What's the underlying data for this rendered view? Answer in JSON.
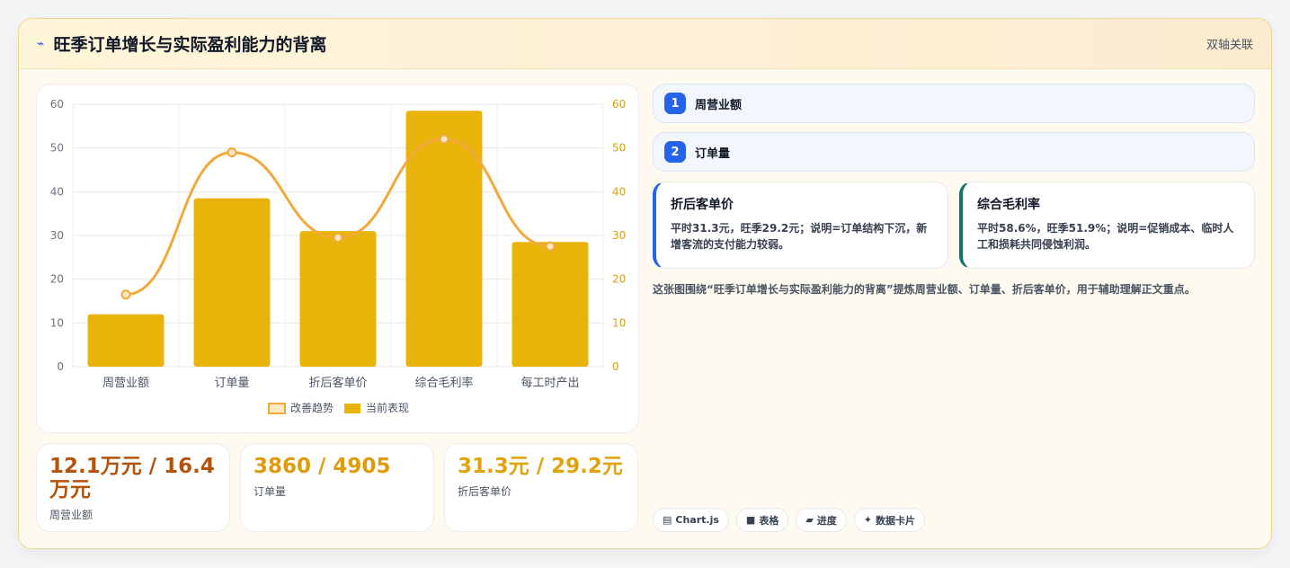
{
  "header": {
    "icon": "trend-icon",
    "title": "旺季订单增长与实际盈利能力的背离",
    "tag": "双轴关联"
  },
  "chart_data": {
    "type": "bar",
    "categories": [
      "周营业额",
      "订单量",
      "折后客单价",
      "综合毛利率",
      "每工时产出"
    ],
    "series": [
      {
        "name": "改善趋势",
        "type": "line",
        "values": [
          16.5,
          49,
          29.5,
          52,
          27.5
        ],
        "color": "#f2a93b"
      },
      {
        "name": "当前表现",
        "type": "bar",
        "values": [
          12,
          38.5,
          31,
          58.5,
          28.5
        ],
        "color": "#e8b40a"
      }
    ],
    "ylim": [
      0,
      60
    ],
    "yticks": [
      0,
      10,
      20,
      30,
      40,
      50,
      60
    ],
    "y2lim": [
      0,
      60
    ],
    "y2ticks": [
      0,
      10,
      20,
      30,
      40,
      50,
      60
    ],
    "grid": true,
    "legend": "bottom"
  },
  "stats": [
    {
      "value": "12.1万元 / 16.4万元",
      "label": "周营业额",
      "color": "#b45309"
    },
    {
      "value": "3860 / 4905",
      "label": "订单量",
      "color": "#e09b0b"
    },
    {
      "value": "31.3元 / 29.2元",
      "label": "折后客单价",
      "color": "#e0a30b"
    }
  ],
  "list": [
    {
      "num": "1",
      "label": "周营业额"
    },
    {
      "num": "2",
      "label": "订单量"
    }
  ],
  "details": [
    {
      "title": "折后客单价",
      "text": "平时31.3元，旺季29.2元；说明=订单结构下沉，新增客流的支付能力较弱。",
      "accent": "#2563eb"
    },
    {
      "title": "综合毛利率",
      "text": "平时58.6%，旺季51.9%；说明=促销成本、临时人工和损耗共同侵蚀利润。",
      "accent": "#0f766e"
    }
  ],
  "note": "这张图围绕“旺季订单增长与实际盈利能力的背离”提炼周营业额、订单量、折后客单价，用于辅助理解正文重点。",
  "tags": [
    {
      "icon": "chart-icon",
      "glyph": "▤",
      "label": "Chart.js"
    },
    {
      "icon": "table-icon",
      "glyph": "■",
      "label": "表格"
    },
    {
      "icon": "progress-icon",
      "glyph": "▰",
      "label": "进度"
    },
    {
      "icon": "sparkle-icon",
      "glyph": "✦",
      "label": "数据卡片"
    }
  ]
}
